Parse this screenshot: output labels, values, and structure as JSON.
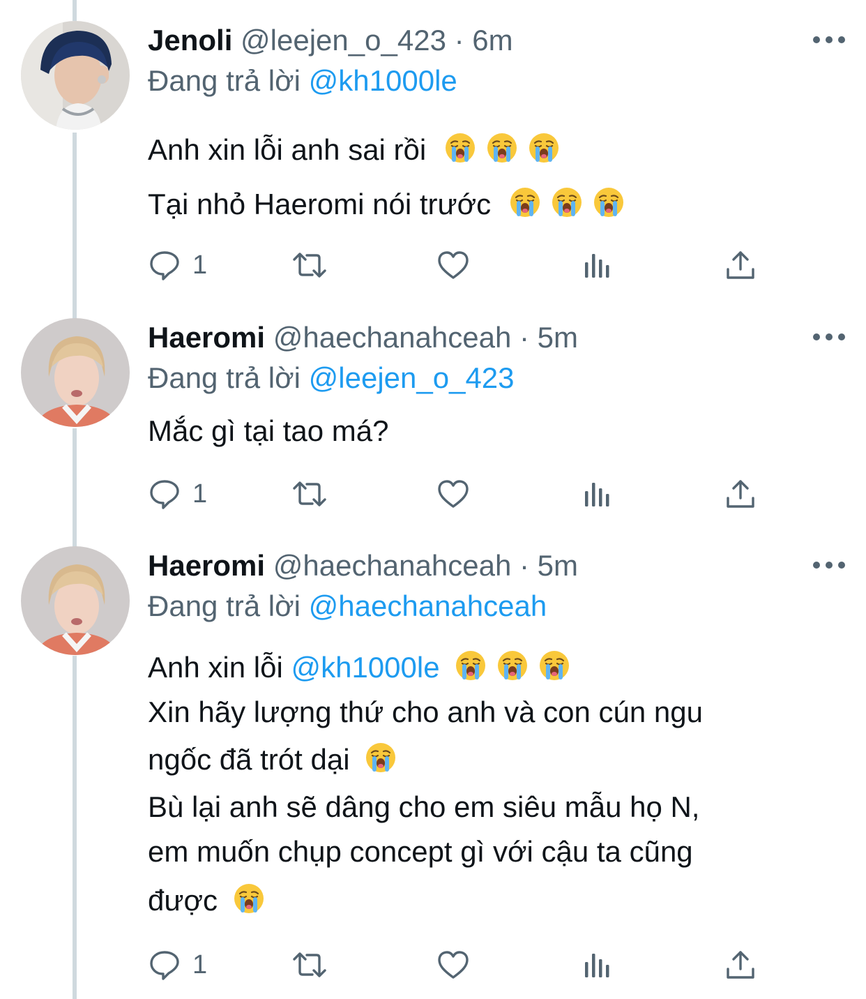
{
  "tweets": [
    {
      "name": "Jenoli",
      "handle": "@leejen_o_423",
      "separator": "·",
      "time": "6m",
      "replying_label": "Đang trả lời",
      "replying_to": "@kh1000le",
      "body_lines": [
        [
          "Anh xin lỗi anh sai rồi",
          "😭😭😭"
        ],
        [
          "Tại nhỏ Haeromi nói trước",
          "😭😭😭"
        ]
      ],
      "reply_count": "1",
      "icons": [
        "reply-icon",
        "retweet-icon",
        "like-icon",
        "analytics-icon",
        "share-icon",
        "more-icon"
      ]
    },
    {
      "name": "Haeromi",
      "handle": "@haechanahceah",
      "separator": "·",
      "time": "5m",
      "replying_label": "Đang trả lời",
      "replying_to": "@leejen_o_423",
      "body_lines": [
        [
          "Mắc gì tại tao má?"
        ]
      ],
      "reply_count": "1"
    },
    {
      "name": "Haeromi",
      "handle": "@haechanahceah",
      "separator": "·",
      "time": "5m",
      "replying_label": "Đang trả lời",
      "replying_to": "@haechanahceah",
      "body_lines": [
        [
          "Anh xin lỗi",
          "@kh1000le",
          "😭😭😭"
        ],
        [
          "Xin hãy lượng thứ cho anh và con cún ngu"
        ],
        [
          "ngốc đã trót dại",
          "😭"
        ],
        [
          "Bù lại anh sẽ dâng cho em siêu mẫu họ N,"
        ],
        [
          "em muốn chụp concept gì với cậu ta cũng"
        ],
        [
          "được",
          "😭"
        ]
      ],
      "reply_count": "1"
    }
  ],
  "colors": {
    "text": "#0f1419",
    "secondary": "#536471",
    "link": "#1d9bf0",
    "thread_line": "#cfd9de"
  }
}
